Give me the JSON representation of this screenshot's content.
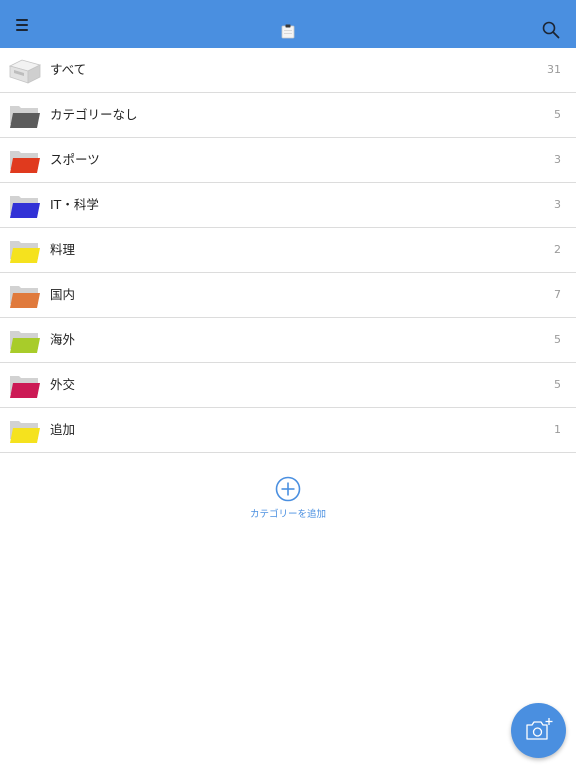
{
  "colors": {
    "header": "#4a8fe0",
    "accent": "#4a8fe0"
  },
  "header": {
    "menu_icon": "hamburger-icon",
    "logo_icon": "clipboard-icon",
    "search_icon": "search-icon"
  },
  "categories": [
    {
      "label": "すべて",
      "count": "31",
      "icon": "inbox-tray-icon",
      "color": "#dedede"
    },
    {
      "label": "カテゴリーなし",
      "count": "5",
      "icon": "folder-icon",
      "color": "#5c5c5c"
    },
    {
      "label": "スポーツ",
      "count": "3",
      "icon": "folder-icon",
      "color": "#e03a1e"
    },
    {
      "label": "IT・科学",
      "count": "3",
      "icon": "folder-icon",
      "color": "#3232d6"
    },
    {
      "label": "料理",
      "count": "2",
      "icon": "folder-icon",
      "color": "#f5e21e"
    },
    {
      "label": "国内",
      "count": "7",
      "icon": "folder-icon",
      "color": "#e07a3c"
    },
    {
      "label": "海外",
      "count": "5",
      "icon": "folder-icon",
      "color": "#a8cc2a"
    },
    {
      "label": "外交",
      "count": "5",
      "icon": "folder-icon",
      "color": "#cc1a55"
    },
    {
      "label": "追加",
      "count": "1",
      "icon": "folder-icon",
      "color": "#f5e21e"
    }
  ],
  "add_category": {
    "label": "カテゴリーを追加",
    "icon": "plus-circle-icon"
  },
  "fab": {
    "icon": "camera-add-icon"
  }
}
